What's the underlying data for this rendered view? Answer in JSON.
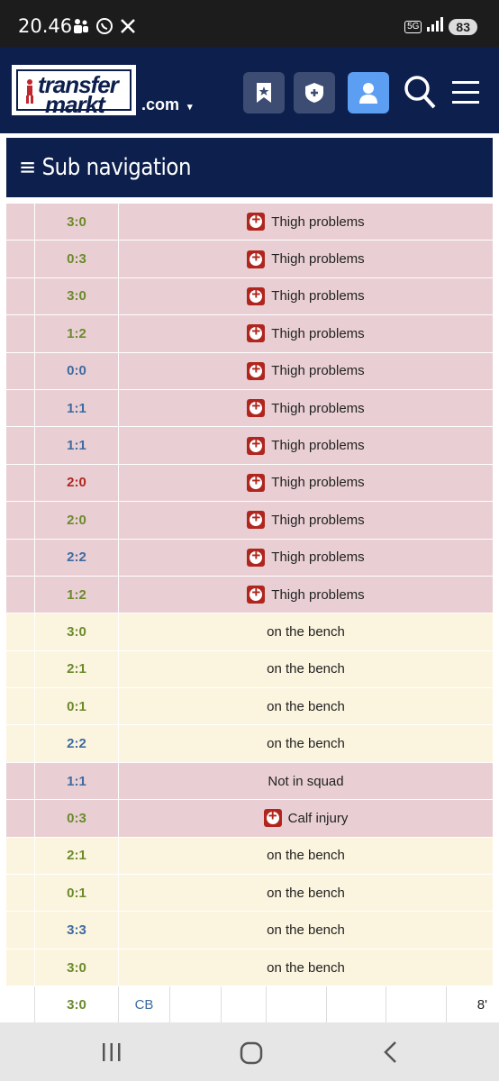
{
  "status_bar": {
    "time": "20.46",
    "network": "5G",
    "battery": "83"
  },
  "header": {
    "logo_line1": "transfer",
    "logo_line2": "markt",
    "domain": ".com"
  },
  "subnav": {
    "label": "≡ Sub navigation"
  },
  "rows": [
    {
      "result": "3:0",
      "res_type": "win",
      "status": "Thigh problems",
      "kind": "injury"
    },
    {
      "result": "0:3",
      "res_type": "win",
      "status": "Thigh problems",
      "kind": "injury"
    },
    {
      "result": "3:0",
      "res_type": "win",
      "status": "Thigh problems",
      "kind": "injury"
    },
    {
      "result": "1:2",
      "res_type": "win",
      "status": "Thigh problems",
      "kind": "injury"
    },
    {
      "result": "0:0",
      "res_type": "draw",
      "status": "Thigh problems",
      "kind": "injury"
    },
    {
      "result": "1:1",
      "res_type": "draw",
      "status": "Thigh problems",
      "kind": "injury"
    },
    {
      "result": "1:1",
      "res_type": "draw",
      "status": "Thigh problems",
      "kind": "injury"
    },
    {
      "result": "2:0",
      "res_type": "loss",
      "status": "Thigh problems",
      "kind": "injury"
    },
    {
      "result": "2:0",
      "res_type": "win",
      "status": "Thigh problems",
      "kind": "injury"
    },
    {
      "result": "2:2",
      "res_type": "draw",
      "status": "Thigh problems",
      "kind": "injury"
    },
    {
      "result": "1:2",
      "res_type": "win",
      "status": "Thigh problems",
      "kind": "injury"
    },
    {
      "result": "3:0",
      "res_type": "win",
      "status": "on the bench",
      "kind": "bench"
    },
    {
      "result": "2:1",
      "res_type": "win",
      "status": "on the bench",
      "kind": "bench"
    },
    {
      "result": "0:1",
      "res_type": "win",
      "status": "on the bench",
      "kind": "bench"
    },
    {
      "result": "2:2",
      "res_type": "draw",
      "status": "on the bench",
      "kind": "bench"
    },
    {
      "result": "1:1",
      "res_type": "draw",
      "status": "Not in squad",
      "kind": "squad"
    },
    {
      "result": "0:3",
      "res_type": "win",
      "status": "Calf injury",
      "kind": "injury"
    },
    {
      "result": "2:1",
      "res_type": "win",
      "status": "on the bench",
      "kind": "bench"
    },
    {
      "result": "0:1",
      "res_type": "win",
      "status": "on the bench",
      "kind": "bench"
    },
    {
      "result": "3:3",
      "res_type": "draw",
      "status": "on the bench",
      "kind": "bench"
    },
    {
      "result": "3:0",
      "res_type": "win",
      "status": "on the bench",
      "kind": "bench"
    }
  ],
  "last_row": {
    "result": "3:0",
    "position": "CB",
    "minutes": "8'"
  },
  "colors": {
    "header_bg": "#0d1f4d",
    "win": "#6b8a2c",
    "draw": "#3d6aa1",
    "loss": "#b0261e",
    "injury_bg": "#e9cfd3",
    "bench_bg": "#fbf4de"
  }
}
